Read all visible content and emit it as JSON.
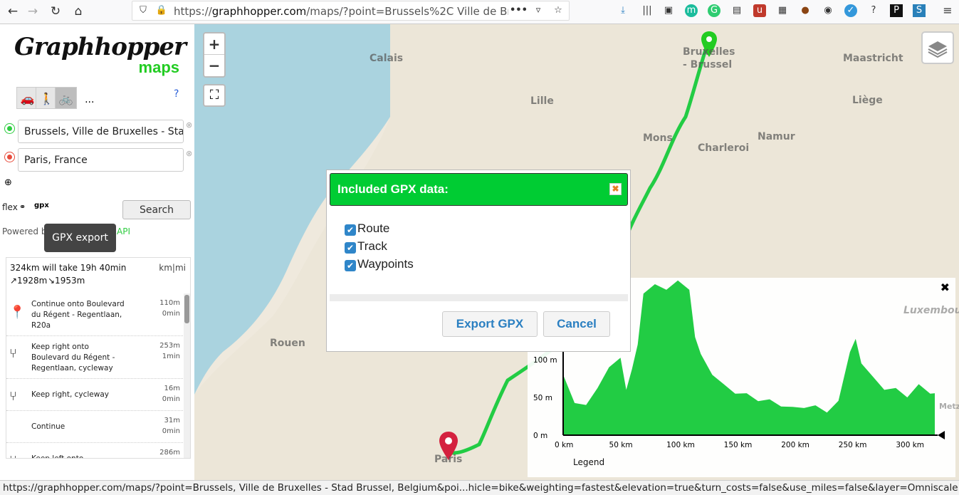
{
  "browser": {
    "url_prefix": "https://",
    "url_host": "graphhopper.com",
    "url_rest": "/maps/?point=Brussels%2C Ville de Bruxe",
    "more_label": "•••",
    "help_label": "?"
  },
  "sidebar": {
    "logo_text": "Graphhopper",
    "logo_sub": "maps",
    "more_vehicles": "...",
    "help": "?",
    "from_value": "Brussels, Ville de Bruxelles - Sta",
    "to_value": "Paris, France",
    "flex_label": "flex",
    "gpx_label": "gpx",
    "search_label": "Search",
    "powered_by": "Powered by",
    "powered_link": "API",
    "tooltip": "GPX export"
  },
  "results": {
    "summary": "324km will take 19h 40min",
    "units": "km|mi",
    "ascend": "↗1928m",
    "descend": "↘1953m",
    "instructions": [
      {
        "text": "Continue onto Boulevard du Régent - Regentlaan, R20a",
        "dist": "110m",
        "time": "0min",
        "icon": "start-marker-icon"
      },
      {
        "text": "Keep right onto Boulevard du Régent - Regentlaan, cycleway",
        "dist": "253m",
        "time": "1min",
        "icon": "keep-right-icon"
      },
      {
        "text": "Keep right, cycleway",
        "dist": "16m",
        "time": "0min",
        "icon": "keep-right-icon"
      },
      {
        "text": "Continue",
        "dist": "31m",
        "time": "0min",
        "icon": "continue-icon"
      },
      {
        "text": "Keep left onto...",
        "dist": "286m",
        "time": "",
        "icon": "keep-left-icon"
      }
    ]
  },
  "map": {
    "labels": [
      "Calais",
      "Bruxelles - Brussel",
      "Maastricht",
      "Lille",
      "Liège",
      "Mons",
      "Namur",
      "Charleroi",
      "Rouen",
      "Paris",
      "Luxembou",
      "Metz"
    ],
    "route_color": "#22cc44"
  },
  "modal": {
    "title": "Included GPX data:",
    "options": [
      "Route",
      "Track",
      "Waypoints"
    ],
    "export_label": "Export GPX",
    "cancel_label": "Cancel"
  },
  "chart_data": {
    "type": "area",
    "xlabel": "",
    "ylabel": "",
    "x_ticks": [
      "0 km",
      "50 km",
      "100 km",
      "150 km",
      "200 km",
      "250 km",
      "300 km"
    ],
    "y_ticks": [
      "0 m",
      "50 m",
      "100 m"
    ],
    "xlim": [
      0,
      324
    ],
    "ylim": [
      0,
      100
    ],
    "x": [
      0,
      10,
      20,
      30,
      40,
      50,
      55,
      60,
      65,
      70,
      80,
      90,
      100,
      110,
      115,
      120,
      130,
      140,
      150,
      160,
      170,
      180,
      190,
      200,
      210,
      220,
      230,
      240,
      250,
      255,
      260,
      270,
      280,
      290,
      300,
      310,
      320,
      324
    ],
    "y": [
      80,
      35,
      40,
      55,
      90,
      95,
      60,
      80,
      120,
      180,
      200,
      185,
      205,
      185,
      130,
      100,
      80,
      60,
      55,
      48,
      45,
      40,
      38,
      30,
      36,
      32,
      30,
      38,
      110,
      120,
      95,
      70,
      60,
      55,
      50,
      60,
      55,
      48
    ],
    "legend": "Legend",
    "fill_color": "#22cc44"
  },
  "statusbar": "https://graphhopper.com/maps/?point=Brussels, Ville de Bruxelles - Stad Brussel, Belgium&poi...hicle=bike&weighting=fastest&elevation=true&turn_costs=false&use_miles=false&layer=Omniscale"
}
